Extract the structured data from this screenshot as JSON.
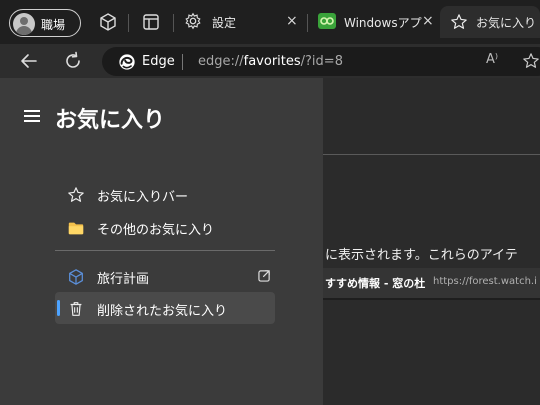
{
  "profile": {
    "label": "職場"
  },
  "tabs": [
    {
      "title": "設定",
      "close": "×"
    },
    {
      "title": "Windowsアプ",
      "close": "×"
    },
    {
      "title": "お気に入り"
    }
  ],
  "address": {
    "brand": "Edge",
    "url_prefix": "edge://",
    "url_host": "favorites",
    "url_rest": "/?id=8",
    "read_aloud": "A⁾"
  },
  "panel": {
    "title": "お気に入り",
    "items": [
      {
        "label": "お気に入りバー",
        "icon": "star-outline-icon"
      },
      {
        "label": "その他のお気に入り",
        "icon": "folder-icon"
      },
      {
        "label": "旅行計画",
        "icon": "collection-cube-icon"
      },
      {
        "label": "削除されたお気に入り",
        "icon": "trash-icon"
      }
    ]
  },
  "main": {
    "partial_text": "に表示されます。これらのアイテ",
    "row_title": "すすめ情報 - 窓の杜",
    "row_url": "https://forest.watch.i"
  },
  "colors": {
    "accent": "#4da3ff",
    "panel": "#3b3b3b",
    "tabbar": "#1f1f1f"
  }
}
